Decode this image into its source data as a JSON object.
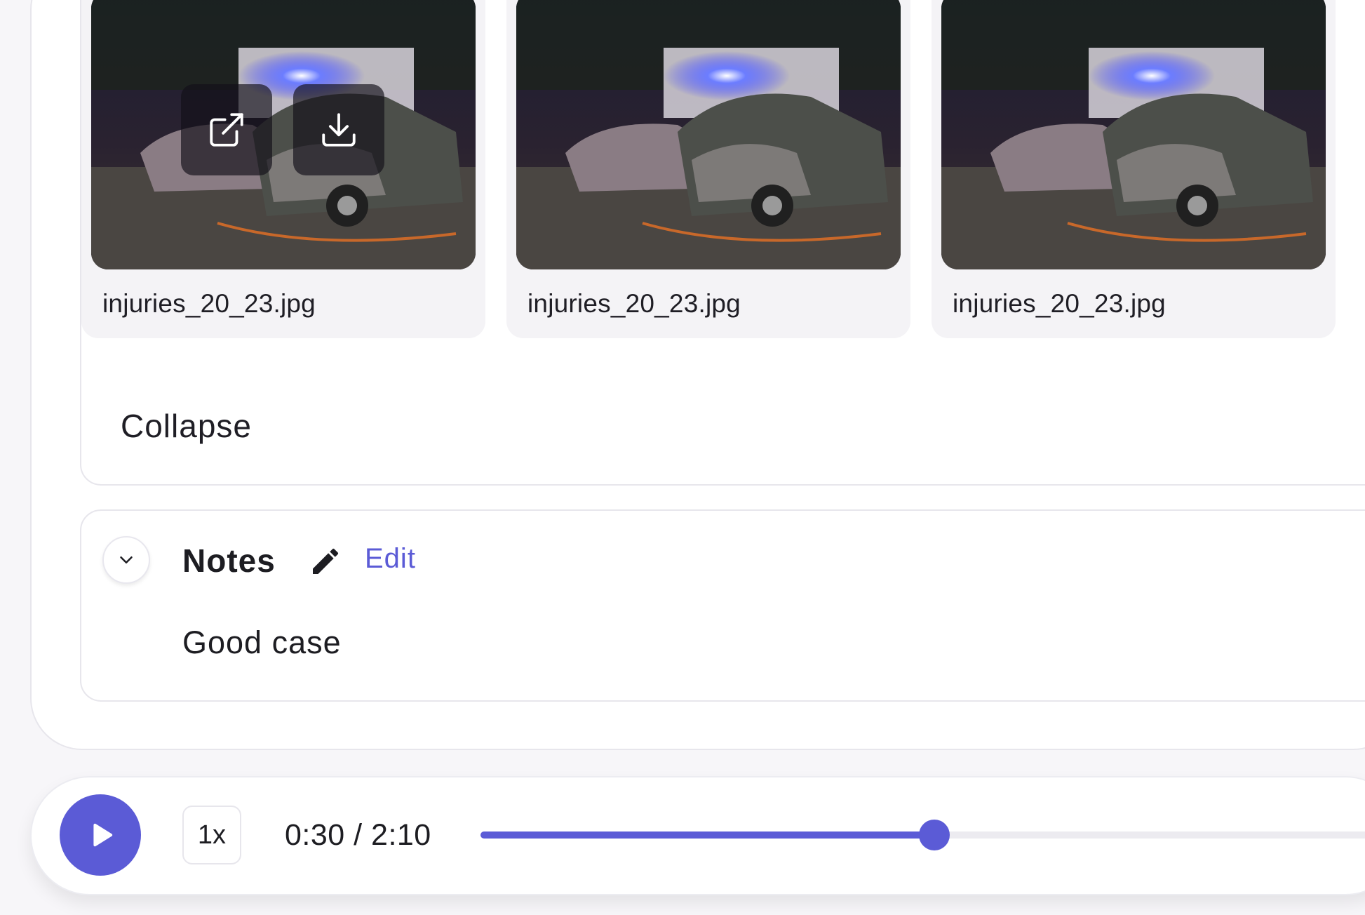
{
  "attachments": {
    "items": [
      {
        "filename": "injuries_20_23.jpg"
      },
      {
        "filename": "injuries_20_23.jpg"
      },
      {
        "filename": "injuries_20_23.jpg"
      }
    ],
    "hover_actions": {
      "open_icon": "external-link-icon",
      "download_icon": "download-icon"
    },
    "collapse_label": "Collapse"
  },
  "notes": {
    "title": "Notes",
    "edit_label": "Edit",
    "body": "Good case",
    "toggle_icon": "chevron-down-icon",
    "edit_icon": "pencil-icon"
  },
  "player": {
    "play_icon": "play-icon",
    "speed_label": "1x",
    "time_label": "0:30 / 2:10",
    "progress": 0.49
  },
  "colors": {
    "accent": "#5b5bd6",
    "text": "#1d1d22",
    "border": "#e7e6ec"
  }
}
